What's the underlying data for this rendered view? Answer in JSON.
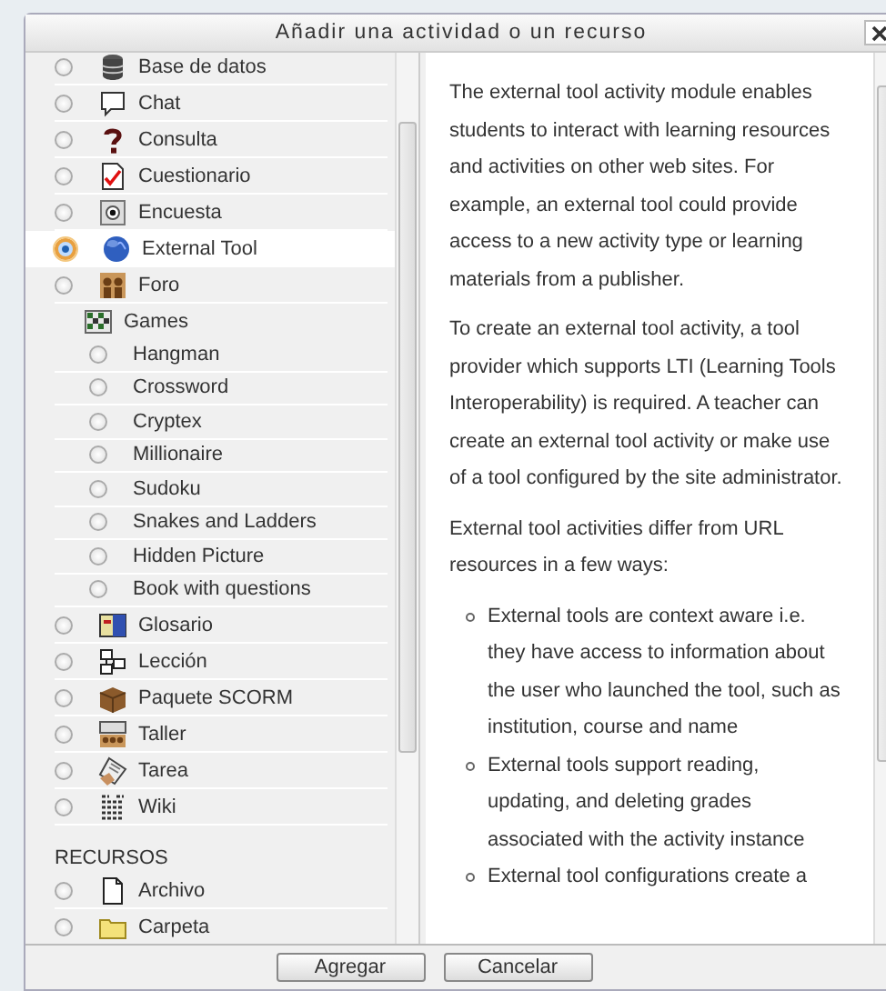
{
  "window": {
    "title": "Añadir una actividad o un recurso"
  },
  "activities": [
    {
      "kind": "option",
      "label": "Base de datos",
      "selected": false
    },
    {
      "kind": "option",
      "label": "Chat",
      "selected": false
    },
    {
      "kind": "option",
      "label": "Consulta",
      "selected": false
    },
    {
      "kind": "option",
      "label": "Cuestionario",
      "selected": false
    },
    {
      "kind": "option",
      "label": "Encuesta",
      "selected": false
    },
    {
      "kind": "option",
      "label": "External Tool",
      "selected": true
    },
    {
      "kind": "option",
      "label": "Foro",
      "selected": false
    },
    {
      "kind": "group",
      "label": "Games",
      "children": [
        {
          "label": "Hangman",
          "selected": false
        },
        {
          "label": "Crossword",
          "selected": false
        },
        {
          "label": "Cryptex",
          "selected": false
        },
        {
          "label": "Millionaire",
          "selected": false
        },
        {
          "label": "Sudoku",
          "selected": false
        },
        {
          "label": "Snakes and Ladders",
          "selected": false
        },
        {
          "label": "Hidden Picture",
          "selected": false
        },
        {
          "label": "Book with questions",
          "selected": false
        }
      ]
    },
    {
      "kind": "option",
      "label": "Glosario",
      "selected": false
    },
    {
      "kind": "option",
      "label": "Lección",
      "selected": false
    },
    {
      "kind": "option",
      "label": "Paquete SCORM",
      "selected": false
    },
    {
      "kind": "option",
      "label": "Taller",
      "selected": false
    },
    {
      "kind": "option",
      "label": "Tarea",
      "selected": false
    },
    {
      "kind": "option",
      "label": "Wiki",
      "selected": false
    }
  ],
  "resources_heading": "RECURSOS",
  "resources": [
    {
      "label": "Archivo",
      "selected": false
    },
    {
      "label": "Carpeta",
      "selected": false
    }
  ],
  "description": {
    "paragraphs": [
      "The external tool activity module enables students to interact with learning resources and activities on other web sites. For example, an external tool could provide access to a new activity type or learning materials from a publisher.",
      "To create an external tool activity, a tool provider which supports LTI (Learning Tools Interoperability) is required. A teacher can create an external tool activity or make use of a tool configured by the site administrator.",
      "External tool activities differ from URL resources in a few ways:"
    ],
    "bullets": [
      "External tools are context aware i.e. they have access to information about the user who launched the tool, such as institution, course and name",
      "External tools support reading, updating, and deleting grades associated with the activity instance",
      "External tool configurations create a"
    ]
  },
  "buttons": [
    "Agregar",
    "Cancelar"
  ]
}
